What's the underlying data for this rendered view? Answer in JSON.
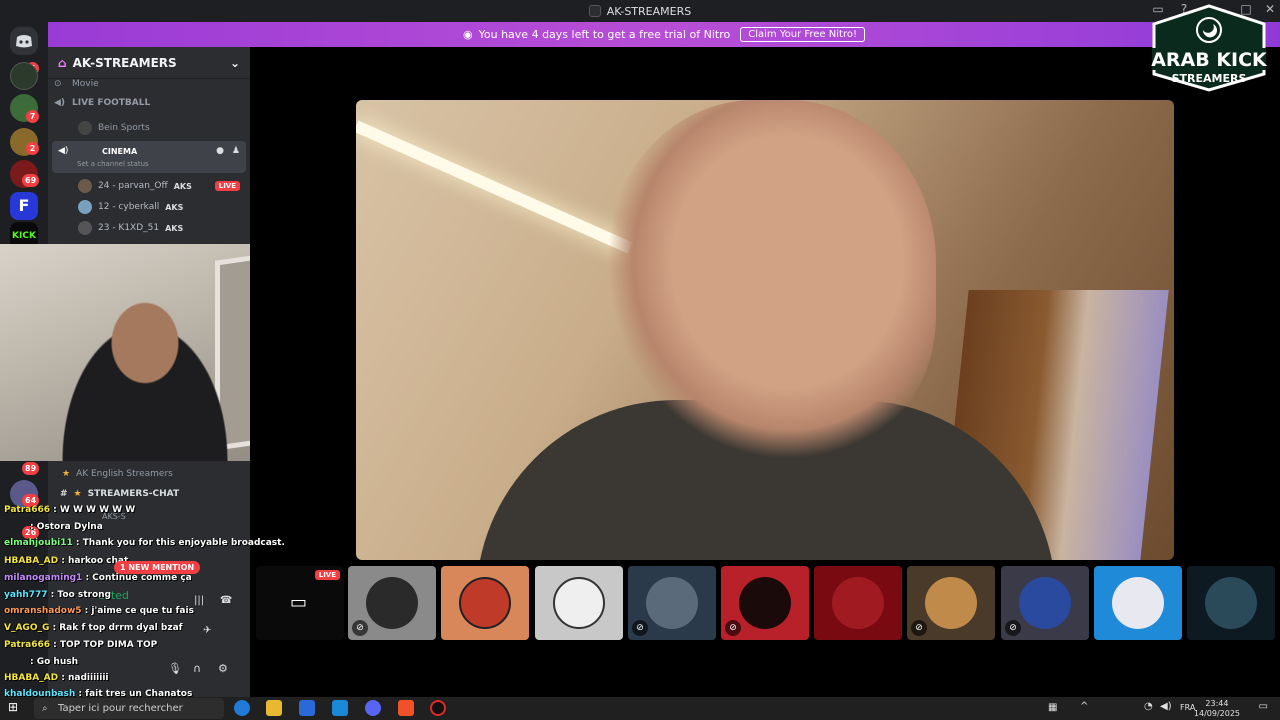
{
  "window": {
    "title": "AK-STREAMERS"
  },
  "nitro_banner": {
    "text": "You have 4 days left to get a free trial of Nitro",
    "cta": "Claim Your Free Nitro!"
  },
  "server_rail": {
    "badges": [
      "5",
      "7",
      "2",
      "69"
    ],
    "bottom_badges": [
      "89",
      "64",
      "26"
    ]
  },
  "sidebar": {
    "server_name": "AK-STREAMERS",
    "category_movie": "Movie",
    "channels": {
      "live_football": "LIVE FOOTBALL",
      "bein": "Bein Sports",
      "cinema": "CINEMA",
      "cinema_status": "Set a channel status"
    },
    "voice_users": [
      {
        "name": "24 - parvan_Off",
        "tag": "AKS",
        "live": "LIVE"
      },
      {
        "name": "12 - cyberkall",
        "tag": "AKS"
      },
      {
        "name": "23 - K1XD_51",
        "tag": "AKS"
      }
    ],
    "lower": {
      "english_category": "AK English Streamers",
      "streamers_chat": "STREAMERS-CHAT",
      "aks_s": "AKS-S",
      "connected": "ected"
    }
  },
  "chat_overlay": [
    {
      "user": "Patra666",
      "text": " : W W W W W W",
      "color": "#f5e642"
    },
    {
      "user": "",
      "text": ": Ostora Dylna",
      "color": "#ffffff"
    },
    {
      "user": "elmahjoubi11",
      "text": " : Thank you for this enjoyable broadcast.",
      "color": "#7cff7c"
    },
    {
      "user": "HBABA_AD",
      "text": " : harkoo chat",
      "color": "#f5e642"
    },
    {
      "user": "milanogaming1",
      "text": " : Continue comme ça",
      "color": "#c48cff"
    },
    {
      "user": "yahh777",
      "text": " : Too strong",
      "color": "#5ee5ff"
    },
    {
      "user": "omranshadow5",
      "text": " : j'aime ce que tu fais",
      "color": "#ff9a57"
    },
    {
      "user": "V_AGO_G",
      "text": " : Rak f top drrm dyal bzaf",
      "color": "#f5e642"
    },
    {
      "user": "Patra666",
      "text": " : TOP TOP DIMA TOP",
      "color": "#f5e642"
    },
    {
      "user": "",
      "text": " : Go hush",
      "color": "#ffffff"
    },
    {
      "user": "HBABA_AD",
      "text": " : nadiiiiiii",
      "color": "#f5e642"
    },
    {
      "user": "khaldounbash",
      "text": " : fait tres un Chanatos",
      "color": "#5ee5ff"
    }
  ],
  "mention_pill": "1 NEW MENTION",
  "stage": {
    "live_label": "LIVE"
  },
  "taskbar": {
    "search_placeholder": "Taper ici pour rechercher",
    "lang": "FRA",
    "time": "23:44",
    "date": "14/09/2025"
  },
  "logo": {
    "line1": "ARAB KICK",
    "line2": "STREAMERS"
  },
  "colors": {
    "blurple": "#5865f2",
    "live_red": "#f23f43",
    "nitro_start": "#9a3bd6",
    "nitro_end": "#8f3ad8"
  }
}
